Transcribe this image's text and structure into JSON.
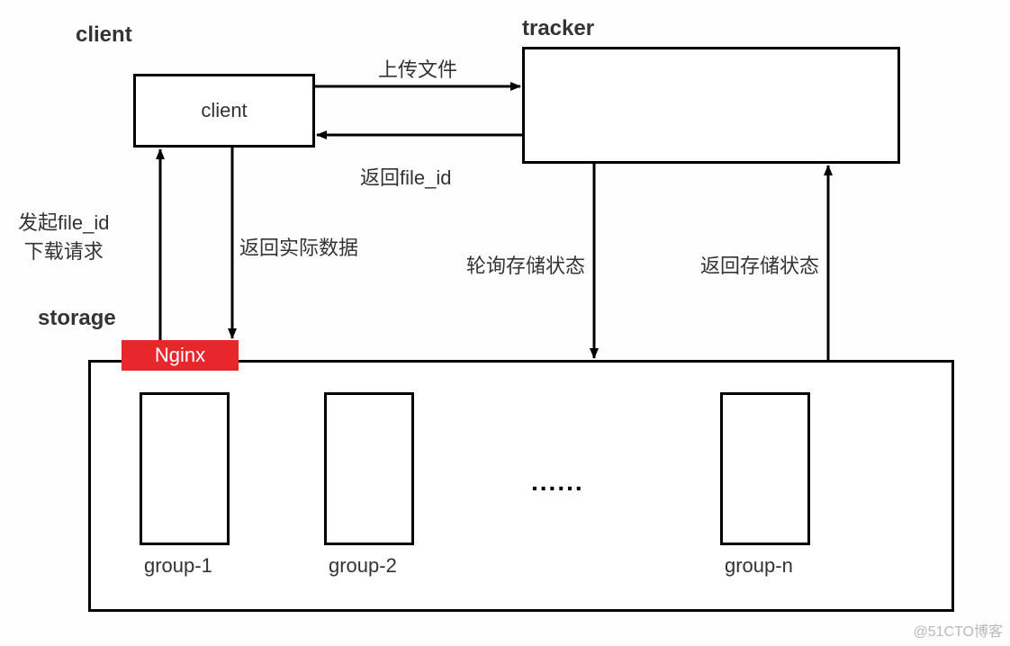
{
  "sections": {
    "client": "client",
    "tracker": "tracker",
    "storage": "storage"
  },
  "boxes": {
    "client": "client",
    "nginx": "Nginx",
    "group1": "group-1",
    "group2": "group-2",
    "groupn": "group-n",
    "ellipsis": "......"
  },
  "arrows": {
    "upload": "上传文件",
    "return_file_id": "返回file_id",
    "file_id_request_line1": "发起file_id",
    "file_id_request_line2": "下载请求",
    "return_actual_data": "返回实际数据",
    "poll_storage_state": "轮询存储状态",
    "return_storage_state": "返回存储状态"
  },
  "watermark": "@51CTO博客"
}
